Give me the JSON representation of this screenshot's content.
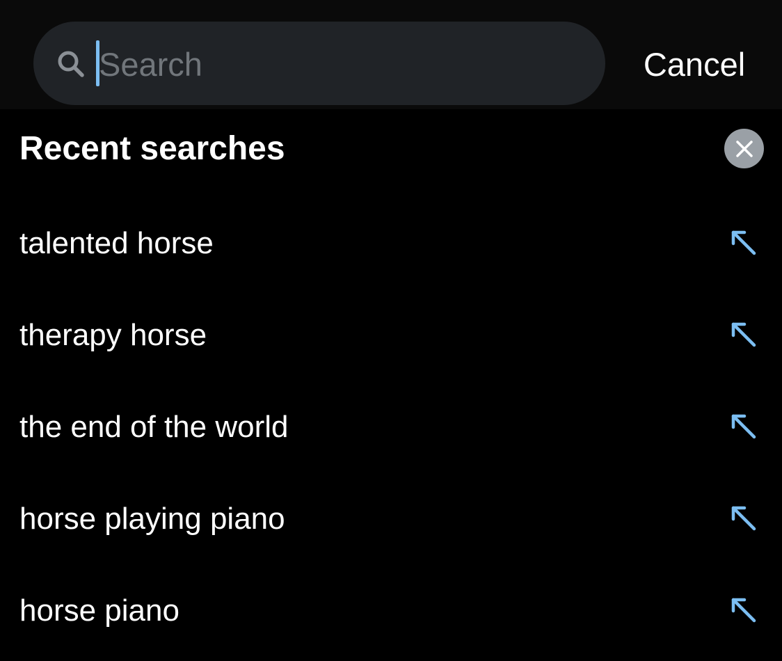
{
  "search": {
    "placeholder": "Search",
    "value": "",
    "cancel_label": "Cancel"
  },
  "recent": {
    "title": "Recent searches",
    "clear_icon": "close-icon",
    "fill_icon": "arrow-up-left-icon",
    "items": [
      {
        "label": "talented horse"
      },
      {
        "label": "therapy horse"
      },
      {
        "label": "the end of the world"
      },
      {
        "label": "horse playing piano"
      },
      {
        "label": "horse piano"
      }
    ]
  },
  "colors": {
    "background": "#000000",
    "search_field": "#202327",
    "accent": "#7cbef2",
    "placeholder": "#71767b",
    "clear_button": "#9aa0a6"
  }
}
